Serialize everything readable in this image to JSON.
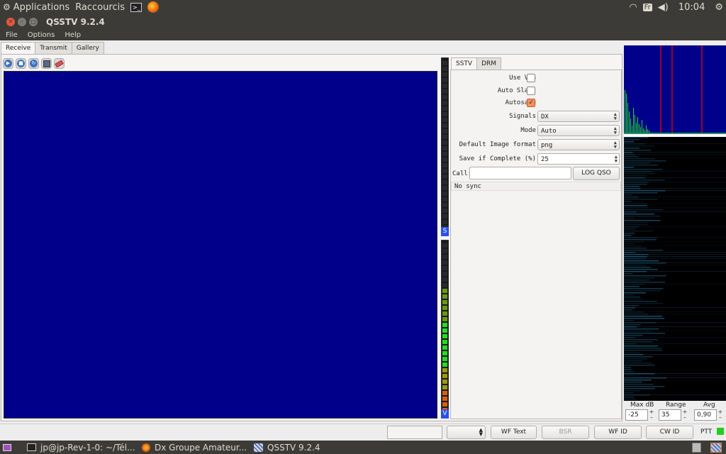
{
  "topbar": {
    "applications": "Applications",
    "shortcuts": "Raccourcis",
    "keyboard_layout": "Fr",
    "clock": "10:04"
  },
  "window": {
    "title": "QSSTV 9.2.4"
  },
  "menu": {
    "file": "File",
    "options": "Options",
    "help": "Help"
  },
  "main_tabs": {
    "receive": "Receive",
    "transmit": "Transmit",
    "gallery": "Gallery"
  },
  "side_tabs": {
    "sstv": "SSTV",
    "drm": "DRM"
  },
  "settings": {
    "use_vis": {
      "label": "Use VIS",
      "checked": false
    },
    "auto_slant": {
      "label": "Auto Slant",
      "checked": false
    },
    "autosave": {
      "label": "Autosave",
      "checked": true
    },
    "signals": {
      "label": "Signals",
      "value": "DX"
    },
    "mode": {
      "label": "Mode",
      "value": "Auto"
    },
    "image_format": {
      "label": "Default Image format",
      "value": "png"
    },
    "save_complete": {
      "label": "Save if Complete (%)",
      "value": "25"
    },
    "call": {
      "label": "Call:",
      "value": ""
    },
    "log_qso": "LOG QSO",
    "sync_status": "No sync"
  },
  "meter_labels": {
    "signal": "S",
    "volume": "V"
  },
  "waterfall": {
    "max_db": {
      "label": "Max dB",
      "value": "-25"
    },
    "range": {
      "label": "Range",
      "value": "35"
    },
    "avg": {
      "label": "Avg",
      "value": "0,90"
    }
  },
  "statusbar": {
    "wf_text": "WF Text",
    "bsr": "BSR",
    "wf_id": "WF ID",
    "cw_id": "CW ID",
    "ptt": "PTT"
  },
  "taskbar": {
    "terminal": "jp@jp-Rev-1-0: ~/Tél...",
    "firefox": "Dx Groupe Amateur...",
    "qsstv": "QSSTV 9.2.4"
  },
  "colors": {
    "rx_background": "#00008b",
    "ptt_indicator": "#22cc22",
    "waterfall_marker": "#cc0000"
  }
}
